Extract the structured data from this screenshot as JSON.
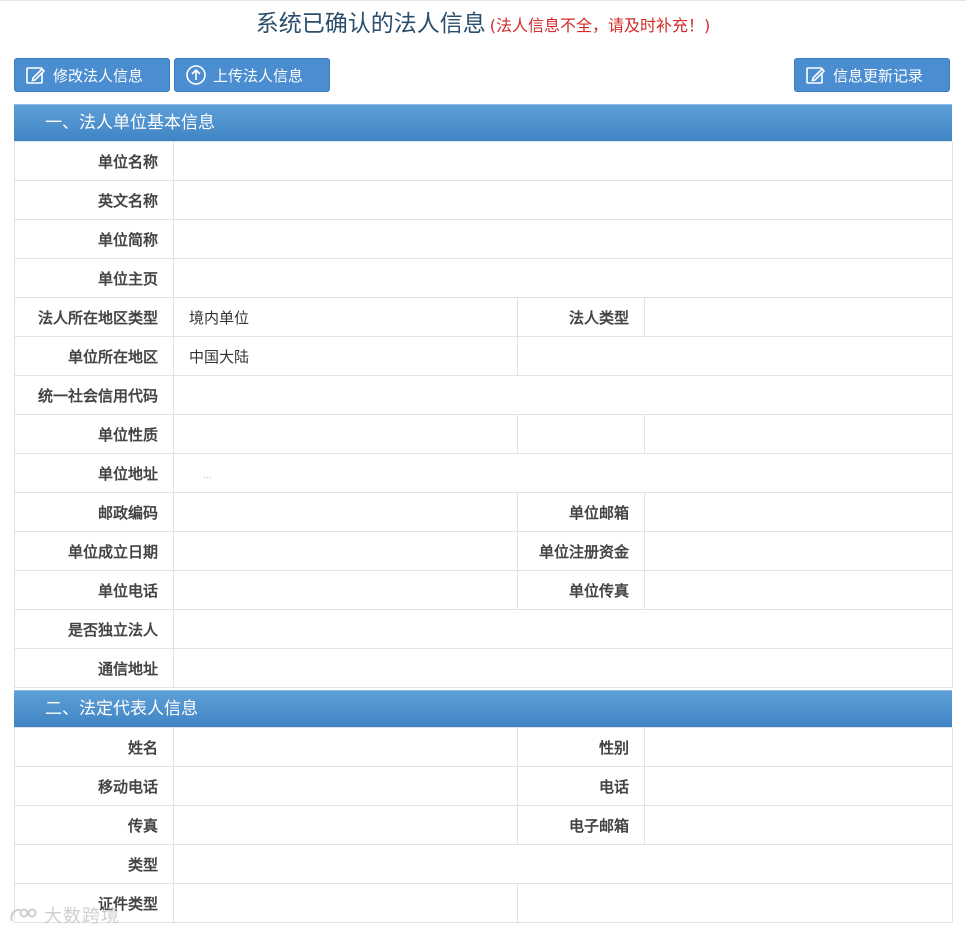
{
  "header": {
    "title": "系统已确认的法人信息",
    "note": "(法人信息不全，请及时补充！)"
  },
  "toolbar": {
    "edit_label": "修改法人信息",
    "upload_label": "上传法人信息",
    "history_label": "信息更新记录"
  },
  "section1": {
    "title": "一、法人单位基本信息",
    "fields": {
      "name": "单位名称",
      "en_name": "英文名称",
      "short_name": "单位简称",
      "homepage": "单位主页",
      "region_type": "法人所在地区类型",
      "region_type_value": "境内单位",
      "legal_type": "法人类型",
      "region": "单位所在地区",
      "region_value": "中国大陆",
      "credit_code": "统一社会信用代码",
      "nature": "单位性质",
      "address": "单位地址",
      "address_value": "...",
      "postcode": "邮政编码",
      "email": "单位邮箱",
      "founded": "单位成立日期",
      "capital": "单位注册资金",
      "phone": "单位电话",
      "fax": "单位传真",
      "independent": "是否独立法人",
      "mail_address": "通信地址"
    }
  },
  "section2": {
    "title": "二、法定代表人信息",
    "fields": {
      "name": "姓名",
      "gender": "性别",
      "mobile": "移动电话",
      "phone": "电话",
      "fax": "传真",
      "email": "电子邮箱",
      "type": "类型",
      "id_type": "证件类型"
    }
  },
  "watermark": {
    "text": "大数跨境"
  }
}
